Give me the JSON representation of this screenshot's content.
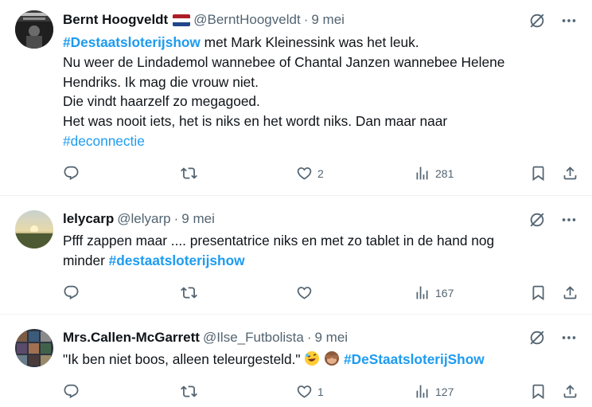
{
  "tweets": [
    {
      "name": "Bernt Hoogveldt",
      "handle": "@BerntHoogveldt",
      "time": "9 mei",
      "lines": {
        "hashtag": "#Destaatsloterijshow",
        "l1_rest": " met Mark Kleinessink was het leuk.",
        "l2": "Nu weer de Lindademol wannebee of Chantal Janzen wannebee Helene",
        "l3": "Hendriks. Ik mag die vrouw niet.",
        "l4": "Die vindt haarzelf zo megagoed.",
        "l5": "Het was nooit iets, het is niks en het wordt niks. Dan maar naar",
        "l6": "#deconnectie"
      },
      "likes": "2",
      "views": "281"
    },
    {
      "name": "lelycarp",
      "handle": "@lelyarp",
      "time": "9 mei",
      "lines": {
        "l1": "Pfff  zappen maar .... presentatrice niks en met zo  tablet in de hand nog",
        "l2_pre": "minder ",
        "hashtag": "#destaatsloterijshow"
      },
      "views": "167"
    },
    {
      "name": "Mrs.Callen-McGarrett",
      "handle": "@Ilse_Futbolista",
      "time": "9 mei",
      "lines": {
        "l1": "\"Ik ben niet boos, alleen teleurgesteld.\"",
        "hashtag": "#DeStaatsloterijShow"
      },
      "likes": "1",
      "views": "127"
    }
  ],
  "separator": "·",
  "icons": {
    "reply": "reply-icon",
    "retweet": "retweet-icon",
    "like": "like-icon",
    "views": "views-icon",
    "bookmark": "bookmark-icon",
    "share": "share-icon",
    "grok": "grok-icon",
    "more": "more-icon"
  },
  "colors": {
    "link": "#1d9bf0",
    "secondary": "#536471",
    "text": "#0f1419"
  }
}
